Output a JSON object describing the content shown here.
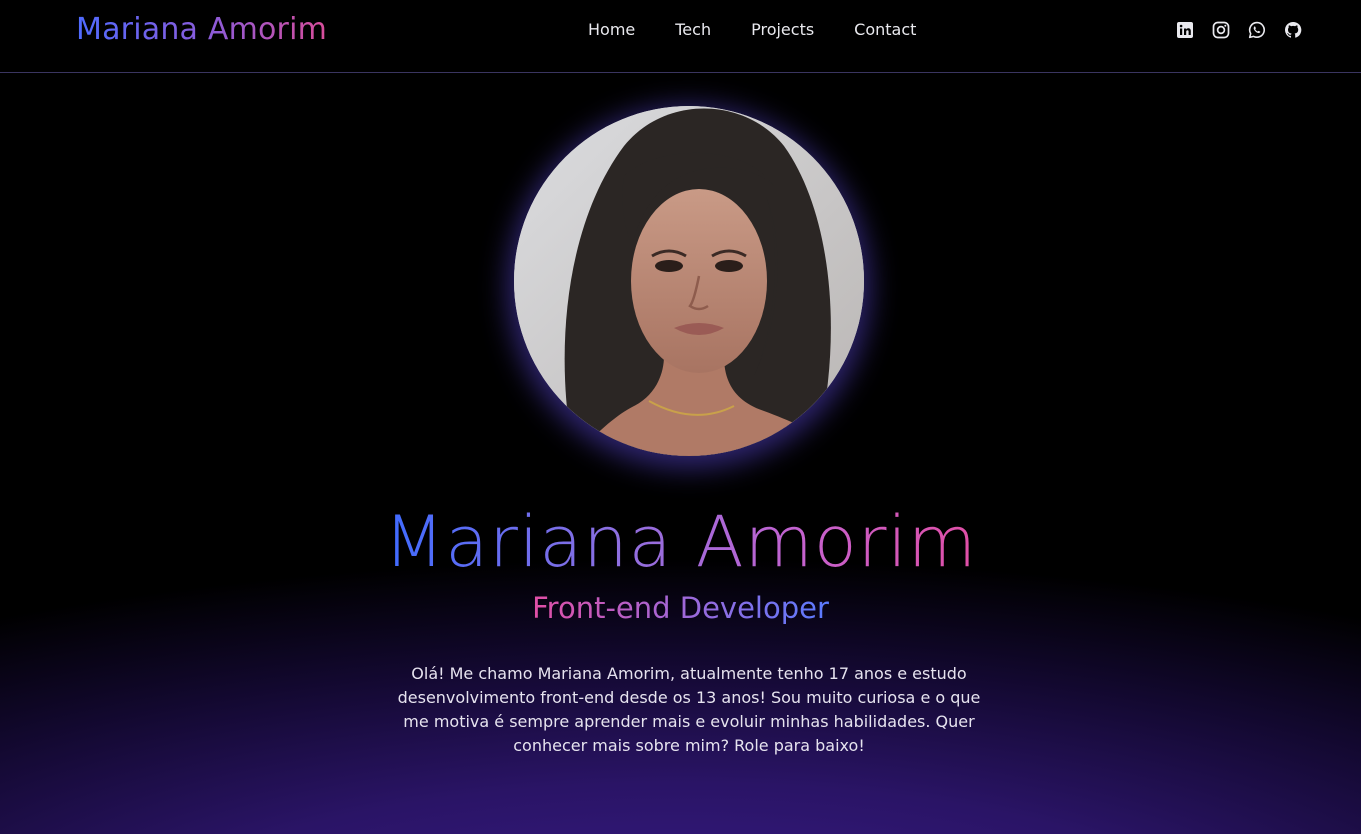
{
  "header": {
    "logo": "Mariana Amorim",
    "nav": [
      {
        "label": "Home"
      },
      {
        "label": "Tech"
      },
      {
        "label": "Projects"
      },
      {
        "label": "Contact"
      }
    ],
    "socials": [
      {
        "icon": "linkedin-icon"
      },
      {
        "icon": "instagram-icon"
      },
      {
        "icon": "whatsapp-icon"
      },
      {
        "icon": "github-icon"
      }
    ]
  },
  "hero": {
    "name": "Mariana Amorim",
    "role": "Front-end Developer",
    "bio": "Olá! Me chamo Mariana Amorim, atualmente tenho 17 anos e estudo desenvolvimento front-end desde os 13 anos! Sou muito curiosa e o que me motiva é sempre aprender mais e evoluir minhas habilidades. Quer conhecer mais sobre mim? Role para baixo!"
  },
  "colors": {
    "accent_blue": "#4f6bff",
    "accent_purple": "#8e5bd8",
    "accent_pink": "#e14fa6",
    "background": "#000000",
    "glow": "#3b1c8f"
  }
}
